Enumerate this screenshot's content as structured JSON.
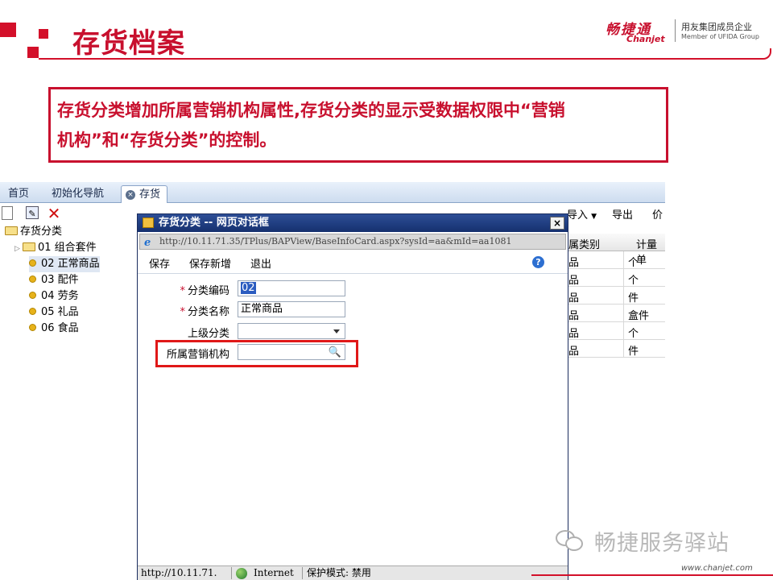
{
  "slide": {
    "title": "存货档案",
    "brand_cn": "畅捷通",
    "brand_en": "Chanjet",
    "brand_member_cn": "用友集团成员企业",
    "brand_member_en": "Member of UFIDA Group",
    "callout_line1": "存货分类增加所属营销机构属性,存货分类的显示受数据权限中“营销",
    "callout_line2": "机构”和“存货分类”的控制。",
    "watermark": "畅捷服务驿站",
    "footer_url": "www.chanjet.com"
  },
  "tabs": [
    {
      "label": "首页"
    },
    {
      "label": "初始化导航"
    },
    {
      "label": "存货",
      "active": true
    }
  ],
  "tree": {
    "root": "存货分类",
    "items": [
      {
        "label": "01 组合套件",
        "type": "folder"
      },
      {
        "label": "02 正常商品",
        "type": "leaf",
        "selected": true
      },
      {
        "label": "03 配件",
        "type": "leaf"
      },
      {
        "label": "04 劳务",
        "type": "leaf"
      },
      {
        "label": "05 礼品",
        "type": "leaf"
      },
      {
        "label": "06 食品",
        "type": "leaf"
      }
    ]
  },
  "right_toolbar": {
    "import": "导入",
    "export": "导出",
    "more": "价"
  },
  "grid": {
    "headers": [
      "属类别",
      "计量单"
    ],
    "rows": [
      [
        "品",
        "个"
      ],
      [
        "品",
        "个"
      ],
      [
        "品",
        "件"
      ],
      [
        "品",
        "盒件"
      ],
      [
        "品",
        "个"
      ],
      [
        "品",
        "件"
      ]
    ]
  },
  "dialog": {
    "title": "存货分类 -- 网页对话框",
    "close": "×",
    "address": "http://10.11.71.35/TPlus/BAPView/BaseInfoCard.aspx?sysId=aa&mId=aa1081",
    "menu": {
      "save": "保存",
      "save_new": "保存新增",
      "exit": "退出",
      "help": "?"
    },
    "fields": {
      "code_label": "分类编码",
      "code_value": "02",
      "name_label": "分类名称",
      "name_value": "正常商品",
      "parent_label": "上级分类",
      "parent_value": "",
      "org_label": "所属营销机构",
      "org_value": ""
    },
    "status": {
      "url": "http://10.11.71.",
      "zone": "Internet",
      "mode": "保护模式: 禁用"
    }
  },
  "colors": {
    "accent_red": "#c8102e",
    "title_bar": "#1e3a7e",
    "highlight_box": "#e01818"
  }
}
